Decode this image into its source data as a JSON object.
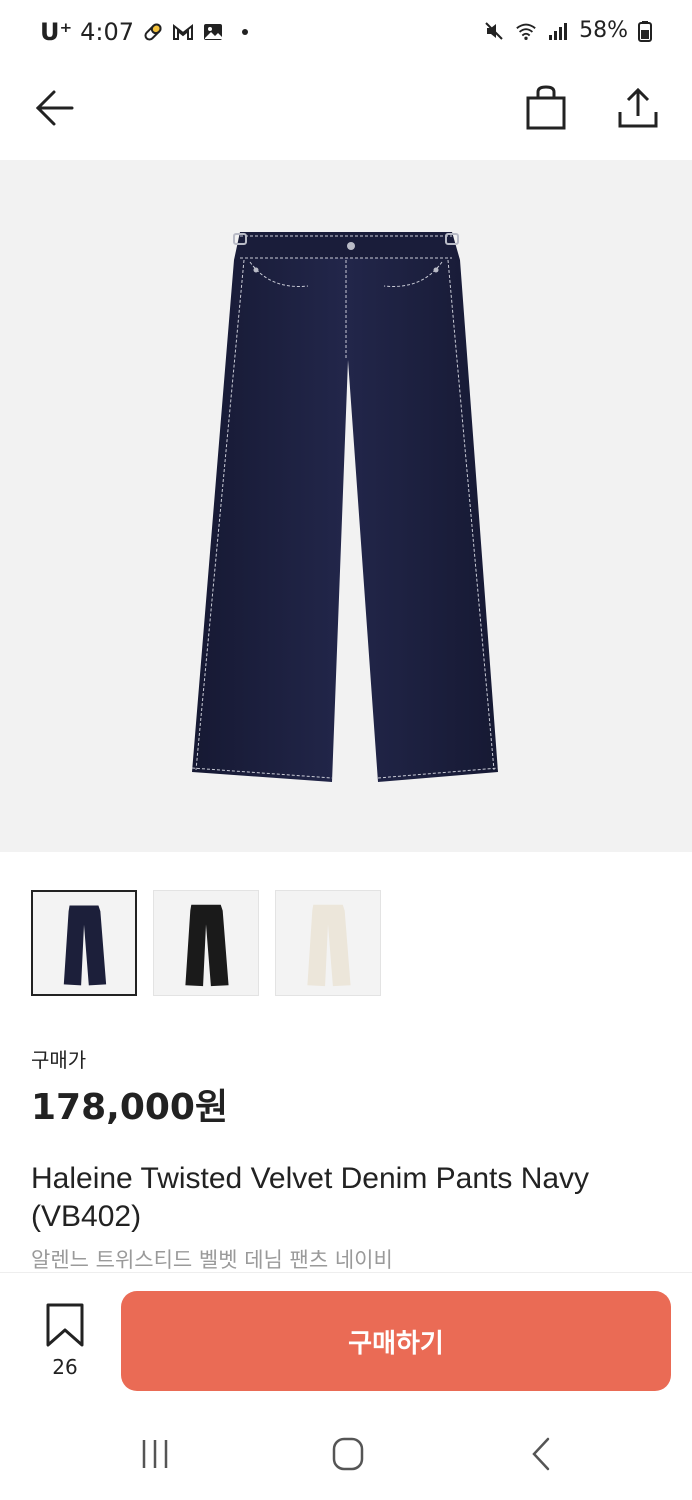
{
  "status_bar": {
    "carrier": "U⁺",
    "time": "4:07",
    "battery": "58%",
    "icons": [
      "pill-icon",
      "gmail-icon",
      "gallery-icon",
      "dot-icon",
      "mute-icon",
      "wifi-icon",
      "signal-icon",
      "battery-icon"
    ]
  },
  "app_bar": {
    "icons": [
      "back-arrow-icon",
      "shopping-bag-icon",
      "share-icon"
    ]
  },
  "product": {
    "price_label": "구매가",
    "price": "178,000원",
    "title": "Haleine Twisted Velvet Denim Pants Navy (VB402)",
    "subtitle": "알렌느 트위스티드 벨벳 데님 팬츠 네이비",
    "colors": {
      "navy": "#1c1f3a",
      "black": "#1a1a1a",
      "cream": "#ece6da"
    },
    "thumbnails": [
      {
        "name": "navy",
        "selected": true
      },
      {
        "name": "black",
        "selected": false
      },
      {
        "name": "cream",
        "selected": false
      }
    ]
  },
  "bottom_bar": {
    "bookmark_count": "26",
    "buy_label": "구매하기",
    "accent": "#ea6b55"
  },
  "nav_bar": {
    "icons": [
      "recent-apps-icon",
      "home-icon",
      "back-icon"
    ]
  }
}
